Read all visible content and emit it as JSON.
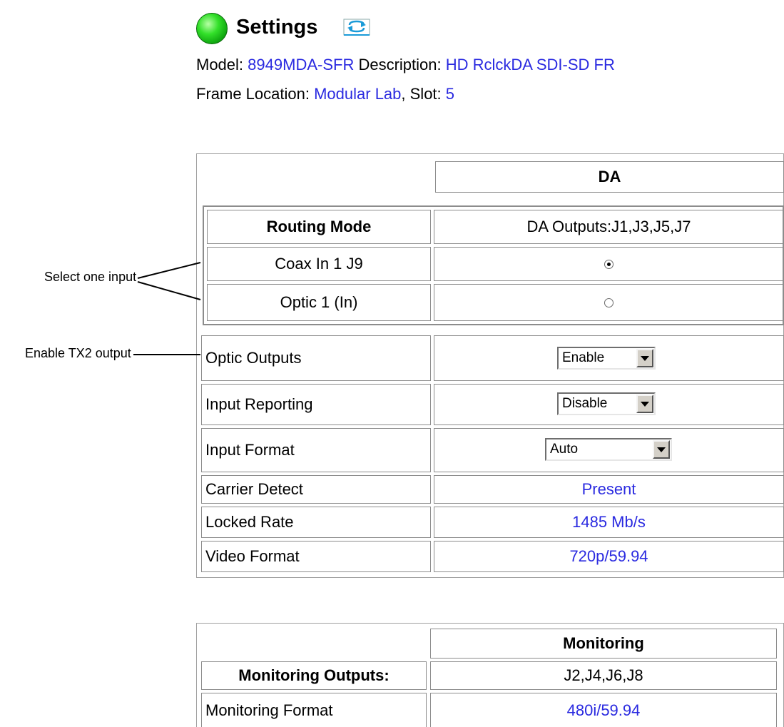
{
  "header": {
    "title": "Settings",
    "model_label": "Model:",
    "model_value": "8949MDA-SFR",
    "description_label": "Description:",
    "description_value": "HD RclckDA SDI-SD FR",
    "frame_location_label": "Frame Location:",
    "frame_location_value": "Modular Lab",
    "slot_label": ", Slot:",
    "slot_value": "5",
    "status_color": "#22cc22",
    "icons": [
      "green-status-icon",
      "refresh-icon"
    ]
  },
  "callouts": {
    "select_input": "Select one input",
    "enable_tx2": "Enable TX2 output"
  },
  "da_table": {
    "header": "DA",
    "routing": {
      "mode_label": "Routing Mode",
      "outputs_label": "DA Outputs:J1,J3,J5,J7",
      "inputs": [
        {
          "label": "Coax In 1 J9",
          "selected": true
        },
        {
          "label": "Optic 1 (In)",
          "selected": false
        }
      ]
    },
    "optic_outputs": {
      "label": "Optic Outputs",
      "value": "Enable"
    },
    "input_reporting": {
      "label": "Input Reporting",
      "value": "Disable"
    },
    "input_format": {
      "label": "Input Format",
      "value": "Auto"
    },
    "carrier_detect": {
      "label": "Carrier Detect",
      "value": "Present"
    },
    "locked_rate": {
      "label": "Locked Rate",
      "value": "1485 Mb/s"
    },
    "video_format": {
      "label": "Video Format",
      "value": "720p/59.94"
    }
  },
  "monitoring_table": {
    "header": "Monitoring",
    "outputs_label": "Monitoring Outputs:",
    "outputs_value": "J2,J4,J6,J8",
    "format_label": "Monitoring Format",
    "format_value": "480i/59.94"
  },
  "colors": {
    "link_blue": "#2a2ae0",
    "border_gray": "#8c8c8c"
  }
}
